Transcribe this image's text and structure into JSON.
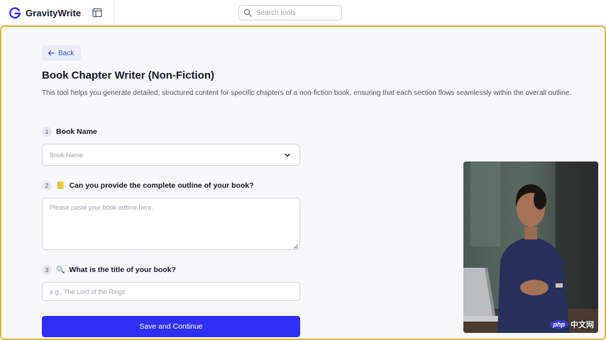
{
  "app": {
    "brand_name": "GravityWrite",
    "brand_color": "#2f2ff5"
  },
  "search": {
    "placeholder": "Search tools",
    "value": ""
  },
  "page": {
    "back_label": "Back",
    "title": "Book Chapter Writer (Non-Fiction)",
    "description": "This tool helps you generate detailed, structured content for specific chapters of a non-fiction book, ensuring that each section flows seamlessly within the overall outline."
  },
  "form": {
    "questions": [
      {
        "number": "1",
        "emoji": "",
        "label": "Book Name",
        "type": "select",
        "placeholder": "Book Name",
        "value": ""
      },
      {
        "number": "2",
        "emoji": "📒",
        "label": "Can you provide the complete outline of your book?",
        "type": "textarea",
        "placeholder": "Please paste your book outline here.",
        "value": ""
      },
      {
        "number": "3",
        "emoji": "🔍",
        "label": "What is the title of your book?",
        "type": "input",
        "placeholder": "e.g., The Lord of the Rings",
        "value": ""
      }
    ],
    "submit_label": "Save and Continue"
  },
  "overlay": {
    "watermark_logo": "php",
    "watermark_text": "中文网"
  },
  "icons": {
    "brand": "gravitywrite-logo-icon",
    "sidebar": "sidebar-toggle-icon",
    "search": "search-icon",
    "back": "arrow-left-icon",
    "select": "chevron-down-icon"
  },
  "colors": {
    "accent": "#2f2ff5",
    "focus_outline": "#e2b53a",
    "back_button_bg": "#e9edf7",
    "back_button_text": "#3b4cc0"
  }
}
